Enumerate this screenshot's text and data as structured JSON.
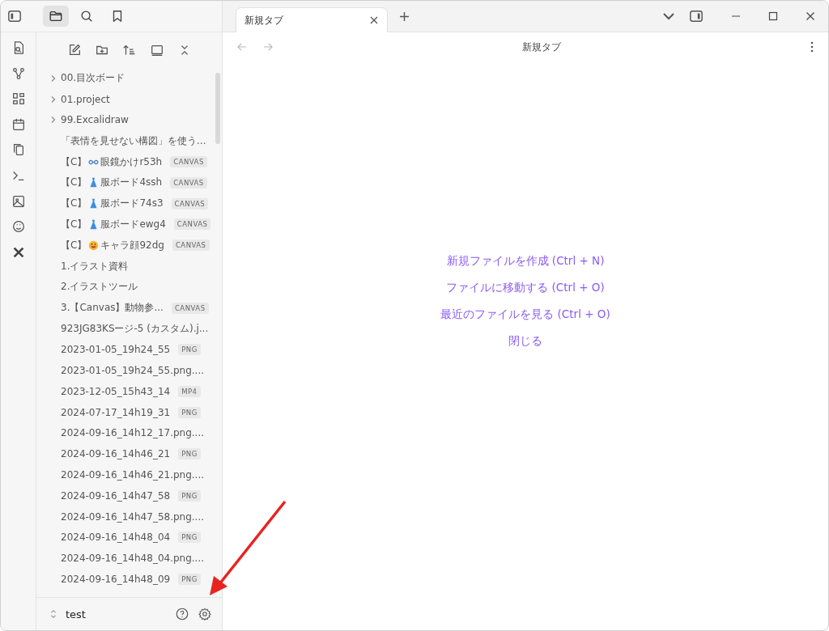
{
  "sidebar_tabs": [
    {
      "selected": true
    },
    {
      "selected": false
    },
    {
      "selected": false
    }
  ],
  "files": [
    {
      "kind": "folder",
      "name": "00.目次ボード"
    },
    {
      "kind": "folder",
      "name": "01.project"
    },
    {
      "kind": "folder",
      "name": "99.Excalidraw"
    },
    {
      "kind": "file",
      "name": "「表情を見せない構図」を使う..."
    },
    {
      "kind": "glasses",
      "prefix": "【C】",
      "name": "眼鏡かけr53h",
      "badge": "CANVAS"
    },
    {
      "kind": "dress",
      "prefix": "【C】",
      "name": "服ボード4ssh",
      "badge": "CANVAS"
    },
    {
      "kind": "dress",
      "prefix": "【C】",
      "name": "服ボード74s3",
      "badge": "CANVAS"
    },
    {
      "kind": "dress",
      "prefix": "【C】",
      "name": "服ボードewg4",
      "badge": "CANVAS"
    },
    {
      "kind": "face",
      "prefix": "【C】",
      "name": "キャラ顔92dg",
      "badge": "CANVAS"
    },
    {
      "kind": "file",
      "name": "1.イラスト資料"
    },
    {
      "kind": "file",
      "name": "2.イラストツール"
    },
    {
      "kind": "file",
      "name": "3.【Canvas】動物参...",
      "badge": "CANVAS"
    },
    {
      "kind": "file",
      "name": "923JG83KSージ-5 (カスタム).j..."
    },
    {
      "kind": "file",
      "name": "2023-01-05_19h24_55",
      "badge": "PNG"
    },
    {
      "kind": "file",
      "name": "2023-01-05_19h24_55.png...."
    },
    {
      "kind": "file",
      "name": "2023-12-05_15h43_14",
      "badge": "MP4"
    },
    {
      "kind": "file",
      "name": "2024-07-17_14h19_31",
      "badge": "PNG"
    },
    {
      "kind": "file",
      "name": "2024-09-16_14h12_17.png...."
    },
    {
      "kind": "file",
      "name": "2024-09-16_14h46_21",
      "badge": "PNG"
    },
    {
      "kind": "file",
      "name": "2024-09-16_14h46_21.png...."
    },
    {
      "kind": "file",
      "name": "2024-09-16_14h47_58",
      "badge": "PNG"
    },
    {
      "kind": "file",
      "name": "2024-09-16_14h47_58.png...."
    },
    {
      "kind": "file",
      "name": "2024-09-16_14h48_04",
      "badge": "PNG"
    },
    {
      "kind": "file",
      "name": "2024-09-16_14h48_04.png...."
    },
    {
      "kind": "file",
      "name": "2024-09-16_14h48_09",
      "badge": "PNG"
    }
  ],
  "vault": {
    "name": "test"
  },
  "tabs": [
    {
      "label": "新規タブ",
      "selected": true
    }
  ],
  "view_title": "新規タブ",
  "actions": [
    "新規ファイルを作成 (Ctrl + N)",
    "ファイルに移動する (Ctrl + O)",
    "最近のファイルを見る (Ctrl + O)",
    "閉じる"
  ]
}
